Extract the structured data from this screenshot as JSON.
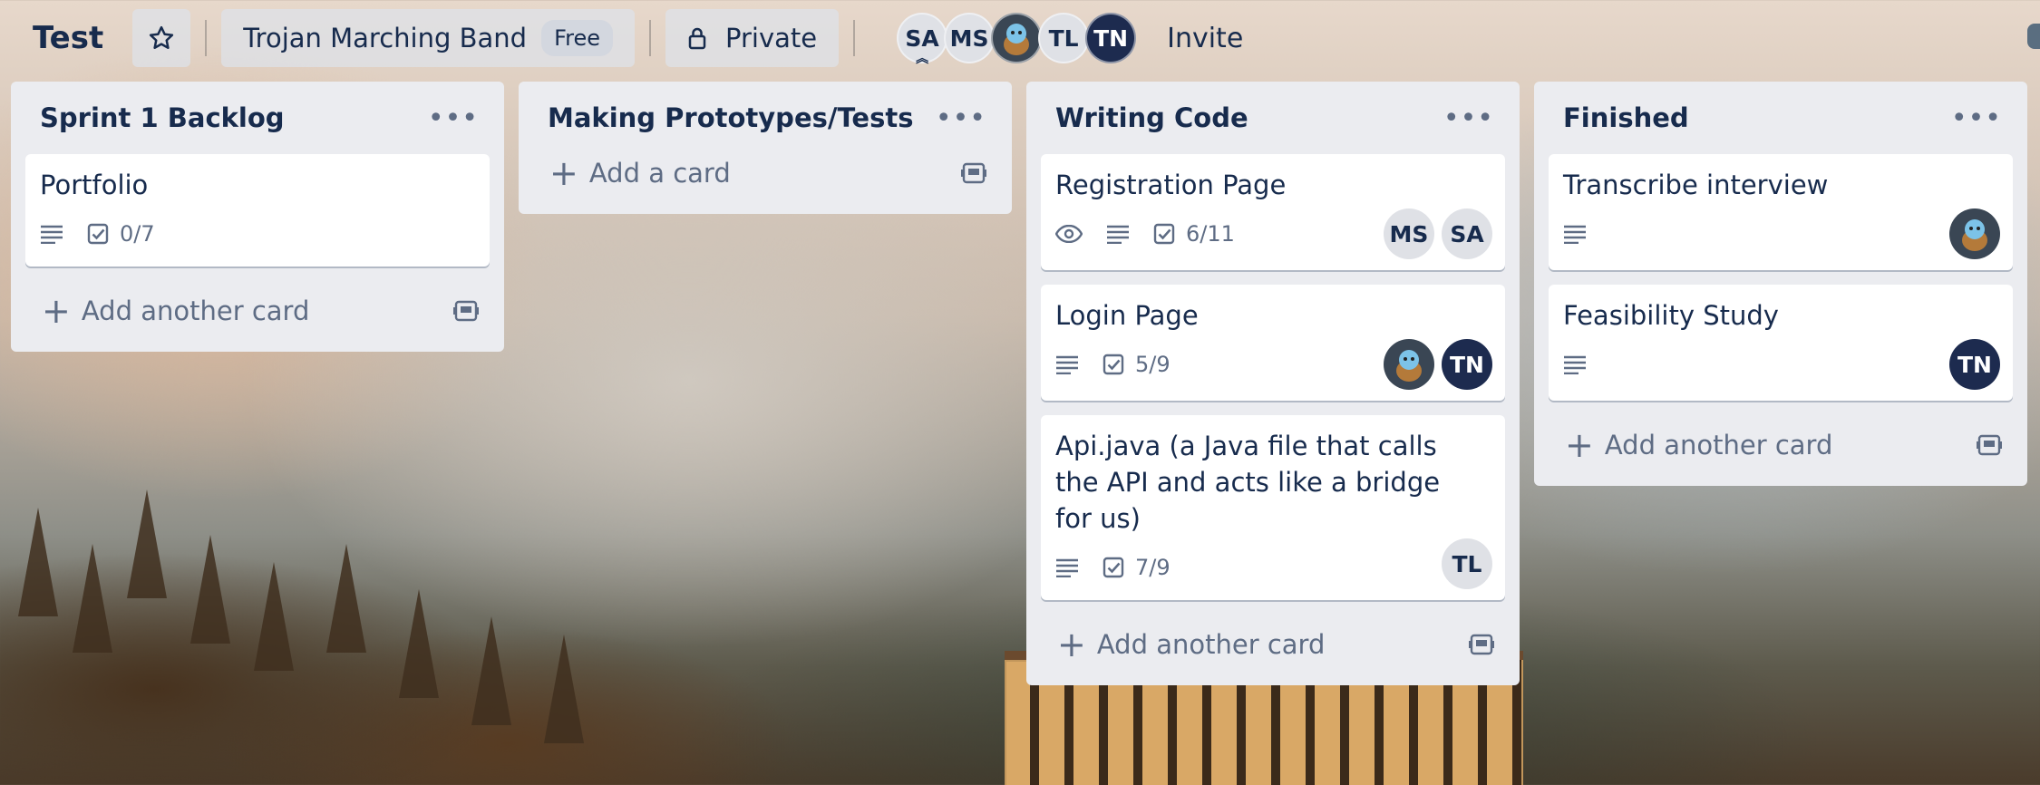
{
  "board": {
    "title": "Test",
    "team_name": "Trojan Marching Band",
    "team_plan": "Free",
    "visibility": "Private",
    "members": [
      {
        "initials": "SA",
        "style": "light",
        "admin": true
      },
      {
        "initials": "MS",
        "style": "light"
      },
      {
        "initials": "",
        "style": "avatar-squirtle"
      },
      {
        "initials": "TL",
        "style": "light"
      },
      {
        "initials": "TN",
        "style": "dark"
      }
    ],
    "invite_label": "Invite"
  },
  "lists": [
    {
      "title": "Sprint 1 Backlog",
      "add_label": "Add another card",
      "cards": [
        {
          "title": "Portfolio",
          "checklist": "0/7",
          "members": []
        }
      ]
    },
    {
      "title": "Making Prototypes/Tests",
      "add_label": "Add a card",
      "cards": []
    },
    {
      "title": "Writing Code",
      "add_label": "Add another card",
      "cards": [
        {
          "title": "Registration Page",
          "checklist": "6/11",
          "members": [
            "MS",
            "SA"
          ]
        },
        {
          "title": "Login Page",
          "checklist": "5/9",
          "members": [
            "squirtle",
            "TN"
          ]
        },
        {
          "title": "Api.java (a Java file that calls the API and acts like a bridge for us)",
          "checklist": "7/9",
          "members": [
            "TL"
          ]
        }
      ]
    },
    {
      "title": "Finished",
      "add_label": "Add another card",
      "cards": [
        {
          "title": "Transcribe interview",
          "members": [
            "squirtle"
          ]
        },
        {
          "title": "Feasibility Study",
          "members": [
            "TN"
          ]
        }
      ]
    }
  ],
  "icons": {
    "star": "star-icon",
    "lock": "lock-icon",
    "watch": "eye-icon",
    "description": "description-icon",
    "checklist": "checklist-icon",
    "template": "card-template-icon",
    "menu": "ellipsis-icon"
  },
  "colors": {
    "list_bg": "#ebecf0",
    "card_bg": "#ffffff",
    "text": "#172b4d",
    "muted": "#5e6c84",
    "avatar_dark": "#1d2b4f",
    "avatar_light": "#dfe1e6"
  }
}
